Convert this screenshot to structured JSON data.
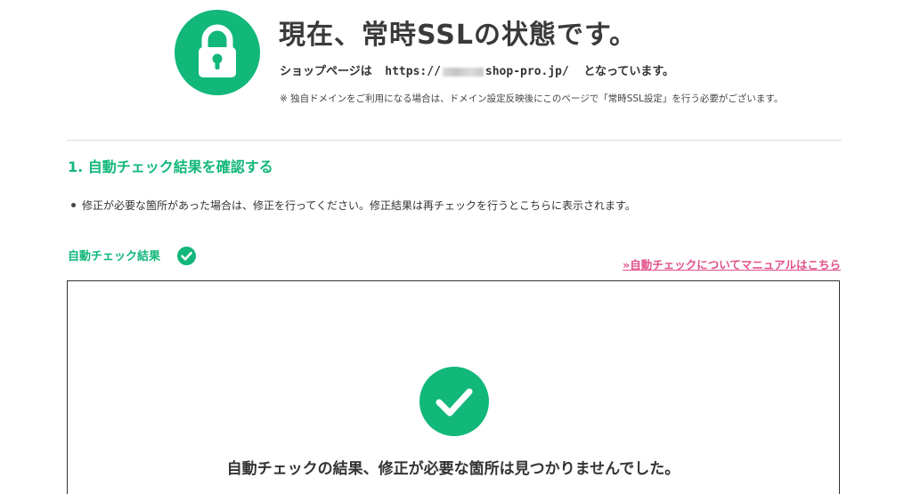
{
  "header": {
    "title": "現在、常時SSLの状態です。",
    "url_prefix": "ショップページは",
    "url_start": "https://",
    "url_domain": "shop-pro.jp/",
    "url_suffix": "となっています。",
    "note": "※ 独自ドメインをご利用になる場合は、ドメイン設定反映後にこのページで「常時SSL設定」を行う必要がございます。",
    "lock_icon": "lock-icon"
  },
  "section": {
    "heading": "1. 自動チェック結果を確認する",
    "bullet": "修正が必要な箇所があった場合は、修正を行ってください。修正結果は再チェックを行うとこちらに表示されます。"
  },
  "result": {
    "label": "自動チェック結果",
    "manual_link": "»自動チェックについてマニュアルはこちら",
    "message": "自動チェックの結果、修正が必要な箇所は見つかりませんでした。"
  },
  "colors": {
    "accent": "#12b77a",
    "link": "#e0528b",
    "text": "#333333"
  }
}
